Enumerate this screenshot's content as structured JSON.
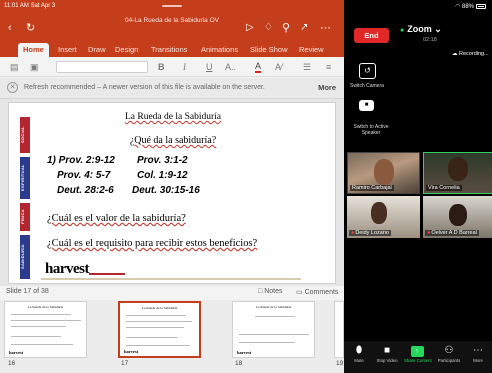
{
  "status_bar": {
    "time": "11:01 AM  Sat Apr 3",
    "battery": "88%"
  },
  "powerpoint": {
    "doc_title": "04-La Rueda de la Sabiduria OV",
    "header_icons": {
      "back": "chevron-left-icon",
      "redo": "redo-icon",
      "play": "play-icon",
      "ideas": "lightbulb-icon",
      "search": "search-icon",
      "share": "share-icon",
      "more": "more-icon"
    },
    "tabs": [
      "Home",
      "Insert",
      "Draw",
      "Design",
      "Transitions",
      "Animations",
      "Slide Show",
      "Review"
    ],
    "active_tab": "Home",
    "ribbon": {
      "bold": "B",
      "italic": "I",
      "underline": "U",
      "font_size": "A..",
      "font_color": "A",
      "clear_format": "A⁄"
    },
    "banner": {
      "message": "Refresh recommended – A newer version of this file is available on the server.",
      "action": "More"
    },
    "slide": {
      "title": "La Rueda de la Sabiduría",
      "question1": "¿Qué da la sabiduría?",
      "verses": [
        "1) Prov. 2:9-12",
        "Prov. 3:1-2",
        "Prov. 4: 5-7",
        "Col. 1:9-12",
        "Deut. 28:2-6",
        "Deut. 30:15-16"
      ],
      "question2": "¿Cuál es el valor de la sabiduría?",
      "question3": "¿Cuál es el requisito para recibir estos beneficios?",
      "logo": "harvest",
      "side_labels": [
        "SOCIAL",
        "ESPIRITUAL",
        "FÍSICA",
        "SABIDURÍA"
      ],
      "side_colors": [
        "#b3262e",
        "#2a3a8c",
        "#b3262e",
        "#2a3a8c"
      ]
    },
    "slide_counter": "Slide 17 of 38",
    "notes_label": "Notes",
    "comments_label": "Comments",
    "thumbnails": [
      {
        "num": "16",
        "title": "La Rueda de la Sabiduría"
      },
      {
        "num": "17",
        "title": "La Rueda de la Sabiduría"
      },
      {
        "num": "18",
        "title": "La Rueda de la Sabiduría"
      },
      {
        "num": "19",
        "title": ""
      }
    ],
    "accent": "#c43e1c"
  },
  "zoom": {
    "end_button": "End",
    "title": "Zoom",
    "timer": "02:18",
    "recording": "Recording...",
    "controls": [
      {
        "label": "Switch Camera",
        "icon": "camera-switch-icon"
      },
      {
        "label": "Switch to Active Speaker",
        "icon": "active-speaker-icon"
      }
    ],
    "participants": [
      {
        "name": "Ramiro Carbajal",
        "muted": false
      },
      {
        "name": "Vira Cornelia",
        "muted": false
      },
      {
        "name": "Deidy Lozano",
        "muted": true
      },
      {
        "name": "Oelver A D Barreal",
        "muted": true
      }
    ],
    "toolbar": [
      {
        "label": "Mute",
        "icon": "mic-icon"
      },
      {
        "label": "Stop Video",
        "icon": "video-icon"
      },
      {
        "label": "Share Content",
        "icon": "share-screen-icon"
      },
      {
        "label": "Participants",
        "icon": "participants-icon"
      },
      {
        "label": "More",
        "icon": "more-icon"
      }
    ],
    "share_color": "#23d95b",
    "end_color": "#e02828"
  }
}
